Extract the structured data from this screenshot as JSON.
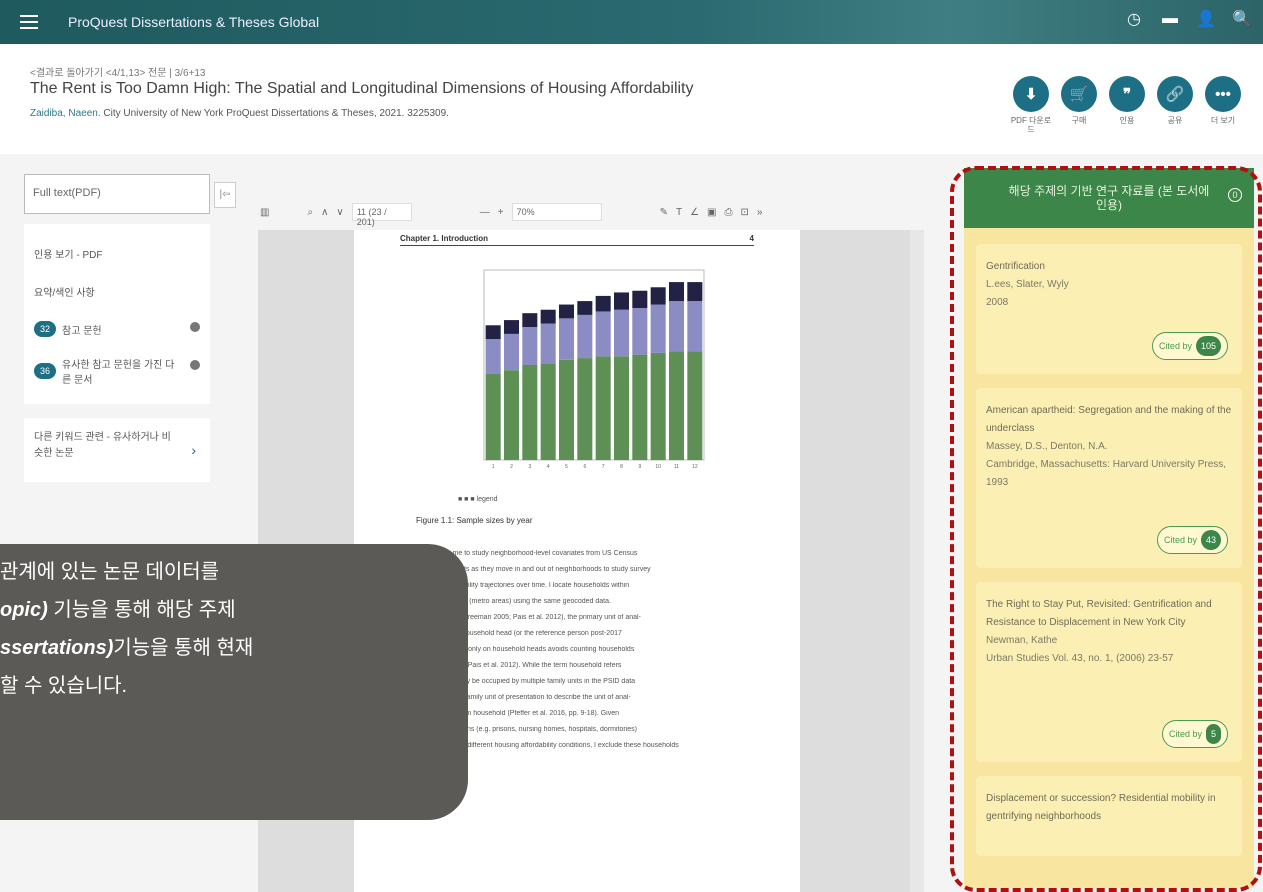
{
  "app": {
    "title": "ProQuest Dissertations & Theses Global"
  },
  "top_icons": [
    {
      "name": "history-icon",
      "glyph": "◷"
    },
    {
      "name": "folder-icon",
      "glyph": "▬"
    },
    {
      "name": "user-icon",
      "glyph": "👤"
    },
    {
      "name": "search-icon",
      "glyph": "🔍"
    }
  ],
  "header": {
    "breadcrumb": "<결과로 돌아가기  <4/1,13>  전문 | 3/6+13",
    "title": "The Rent is Too Damn High: The Spatial and Longitudinal Dimensions of Housing Affordability",
    "author": "Zaidiba, Naeen.",
    "meta": "City University of New York ProQuest Dissertations & Theses, 2021. 3225309."
  },
  "actions": [
    {
      "name": "download-button",
      "glyph": "⬇",
      "label": "PDF 다운로드"
    },
    {
      "name": "cart-button",
      "glyph": "🛒",
      "label": "구매"
    },
    {
      "name": "cite-button",
      "glyph": "❞",
      "label": "인용"
    },
    {
      "name": "link-button",
      "glyph": "🔗",
      "label": "공유"
    },
    {
      "name": "more-button",
      "glyph": "•••",
      "label": "더 보기"
    }
  ],
  "left": {
    "pdf_button": "Full text(PDF)",
    "collapse": "|⇦",
    "items": [
      {
        "label": "인용 보기 - PDF"
      },
      {
        "label": "요약/색인 사항"
      },
      {
        "pill": "32",
        "label": "참고 문헌"
      },
      {
        "pill": "36",
        "label": "유사한 참고 문헌을 가진 다른 문서"
      }
    ],
    "related": "다른 키워드 관련 - 유사하거나 비슷한 논문",
    "related_chevron": "›"
  },
  "viewer": {
    "page": "11 (23 / 201)",
    "zoom": "70%",
    "chapter": "Chapter 1. Introduction",
    "chapter_num": "4",
    "caption": "Figure 1.1: Sample sizes by year",
    "legend": "■ ■ ■ legend",
    "para": [
      "This allows me to study neighborhood-level covariates from US Census",
      "household heads as they move in and out of neighborhoods to study survey",
      "housing affordability trajectories over time. I locate households within",
      "housing markets (metro areas) using the same geocoded data.",
      "prior research (Freeman 2005; Pais et al. 2012), the primary unit of anal-",
      "defined as the household head (or the reference person post-2017",
      "2013). Focusing only on household heads avoids counting households",
      "(Freeman 2005; Pais et al. 2012). While the term household refers",
      "dwelling that may be occupied by multiple family units in the PSID data",
      ", I use the term family unit of presentation to describe the unit of anal-",
      "able with the term household (Pfeffer et al. 2016, pp. 9-18). Given",
      "living in institutions (e.g. prisons, nursing homes, hospitals, dormitories)",
      "experience very different housing affordability conditions, I exclude these households"
    ]
  },
  "tooltip": {
    "line1": "관계에 있는 논문 데이터를",
    "line2_em": "opic)",
    "line2": " 기능을 통해 해당 주제",
    "line3_em": "ssertations)",
    "line3": "기능을 통해 현재",
    "line4": "할 수 있습니다."
  },
  "right": {
    "header": "해당 주제의 기반 연구 자료를 (본 도서에 인용)",
    "badge": "0",
    "cite_label": "Cited by",
    "items": [
      {
        "title": "Gentrification",
        "authors": "L.ees, Slater, Wyly",
        "pub": "2008",
        "count": "105"
      },
      {
        "title": "American apartheid: Segregation and the making of the underclass",
        "authors": "Massey, D.S., Denton, N.A.",
        "pub": "Cambridge, Massachusetts: Harvard University Press, 1993",
        "count": "43"
      },
      {
        "title": "The Right to Stay Put, Revisited: Gentrification and Resistance to Displacement in New York City",
        "authors": "Newman, Kathe",
        "pub": "Urban Studies Vol. 43, no. 1, (2006) 23-57",
        "count": "5"
      },
      {
        "title": "Displacement or succession? Residential mobility in gentrifying neighborhoods",
        "authors": "",
        "pub": "",
        "count": ""
      }
    ]
  },
  "chart_data": {
    "type": "bar",
    "title": "",
    "xlabel": "",
    "ylabel": "",
    "categories": [
      "1",
      "2",
      "3",
      "4",
      "5",
      "6",
      "7",
      "8",
      "9",
      "10",
      "11",
      "12"
    ],
    "series": [
      {
        "values": [
          5.0,
          5.2,
          5.5,
          5.6,
          5.8,
          5.9,
          6.0,
          6.0,
          6.1,
          6.2,
          6.3,
          6.3
        ]
      },
      {
        "values": [
          2.0,
          2.1,
          2.2,
          2.3,
          2.4,
          2.5,
          2.6,
          2.7,
          2.7,
          2.8,
          2.9,
          2.9
        ]
      },
      {
        "values": [
          0.8,
          0.8,
          0.8,
          0.8,
          0.8,
          0.8,
          0.9,
          1.0,
          1.0,
          1.0,
          1.1,
          1.1
        ]
      }
    ],
    "ylim": [
      0,
      11
    ],
    "colors": [
      "#5e8f55",
      "#8b8cc4",
      "#232244"
    ]
  }
}
